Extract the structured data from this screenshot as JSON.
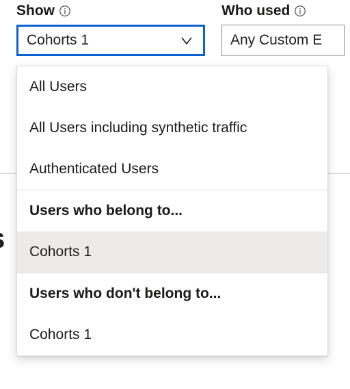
{
  "filters": {
    "show": {
      "label": "Show",
      "value": "Cohorts 1"
    },
    "who_used": {
      "label": "Who used",
      "value": "Any Custom E"
    }
  },
  "dropdown": {
    "options": [
      {
        "label": "All Users",
        "kind": "item",
        "selected": false
      },
      {
        "label": "All Users including synthetic traffic",
        "kind": "item",
        "selected": false
      },
      {
        "label": "Authenticated Users",
        "kind": "item",
        "selected": false
      },
      {
        "label": "Users who belong to...",
        "kind": "header",
        "selected": false
      },
      {
        "label": "Cohorts 1",
        "kind": "item",
        "selected": true
      },
      {
        "label": "Users who don't belong to...",
        "kind": "header",
        "selected": false
      },
      {
        "label": "Cohorts 1",
        "kind": "item",
        "selected": false
      }
    ]
  },
  "background_text": {
    "partial_heading": "s"
  }
}
